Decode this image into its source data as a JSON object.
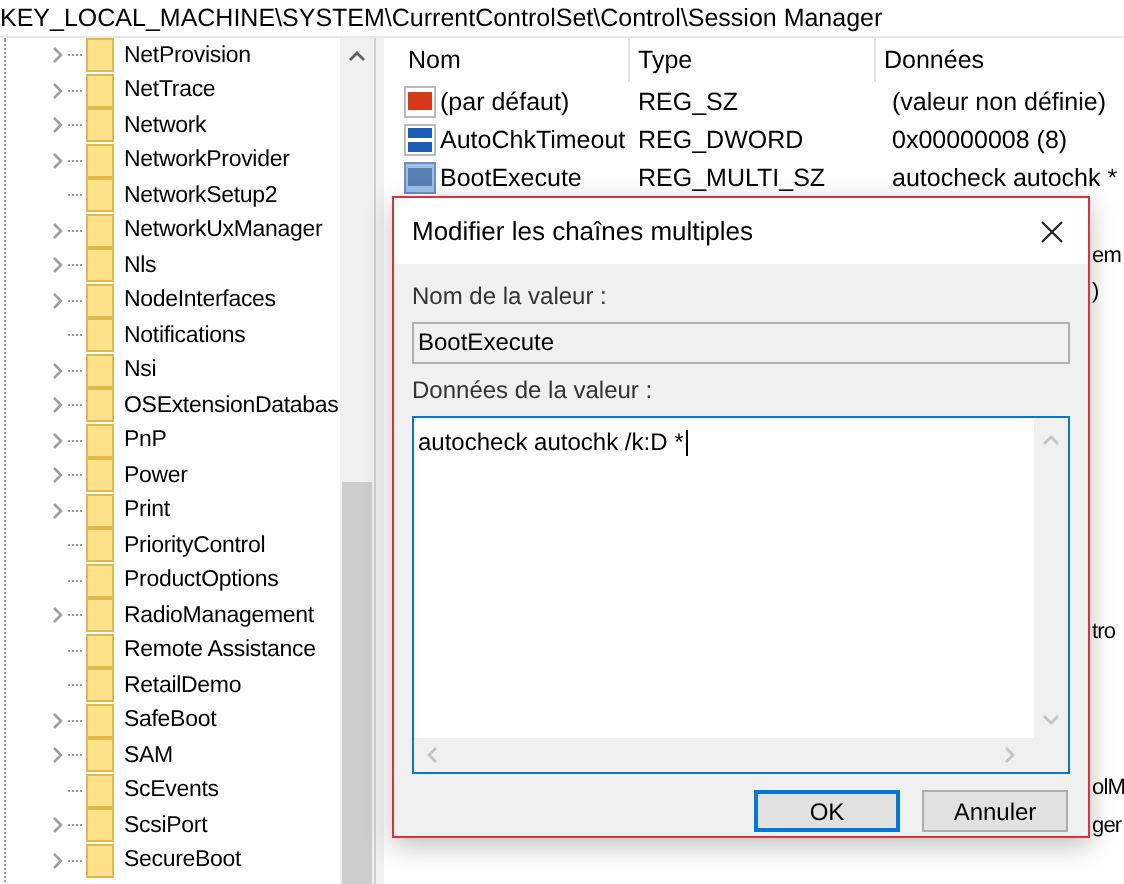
{
  "path_bar": {
    "text": "KEY_LOCAL_MACHINE\\SYSTEM\\CurrentControlSet\\Control\\Session Manager"
  },
  "tree": {
    "items": [
      {
        "label": "NetProvision",
        "expandable": true
      },
      {
        "label": "NetTrace",
        "expandable": true
      },
      {
        "label": "Network",
        "expandable": true
      },
      {
        "label": "NetworkProvider",
        "expandable": true
      },
      {
        "label": "NetworkSetup2",
        "expandable": false
      },
      {
        "label": "NetworkUxManager",
        "expandable": true
      },
      {
        "label": "Nls",
        "expandable": true
      },
      {
        "label": "NodeInterfaces",
        "expandable": true
      },
      {
        "label": "Notifications",
        "expandable": false
      },
      {
        "label": "Nsi",
        "expandable": true
      },
      {
        "label": "OSExtensionDatabas",
        "expandable": true
      },
      {
        "label": "PnP",
        "expandable": true
      },
      {
        "label": "Power",
        "expandable": true
      },
      {
        "label": "Print",
        "expandable": true
      },
      {
        "label": "PriorityControl",
        "expandable": false
      },
      {
        "label": "ProductOptions",
        "expandable": false
      },
      {
        "label": "RadioManagement",
        "expandable": true
      },
      {
        "label": "Remote Assistance",
        "expandable": false
      },
      {
        "label": "RetailDemo",
        "expandable": false
      },
      {
        "label": "SafeBoot",
        "expandable": true
      },
      {
        "label": "SAM",
        "expandable": true
      },
      {
        "label": "ScEvents",
        "expandable": false
      },
      {
        "label": "ScsiPort",
        "expandable": true
      },
      {
        "label": "SecureBoot",
        "expandable": true
      }
    ]
  },
  "values": {
    "columns": [
      "Nom",
      "Type",
      "Données"
    ],
    "rows": [
      {
        "kind": "string",
        "name": "(par défaut)",
        "type": "REG_SZ",
        "data": "(valeur non définie)"
      },
      {
        "kind": "binary",
        "name": "AutoChkTimeout",
        "type": "REG_DWORD",
        "data": "0x00000008 (8)"
      },
      {
        "kind": "multi",
        "name": "BootExecute",
        "type": "REG_MULTI_SZ",
        "data": "autocheck autochk *"
      }
    ],
    "hidden_fragments": [
      "em",
      ")",
      "tro",
      "olM",
      "ger"
    ]
  },
  "dialog": {
    "title": "Modifier les chaînes multiples",
    "name_label": "Nom de la valeur :",
    "name_value": "BootExecute",
    "data_label": "Données de la valeur :",
    "data_value": "autocheck autochk /k:D *",
    "buttons": [
      {
        "label": "OK",
        "default": true
      },
      {
        "label": "Annuler",
        "default": false
      }
    ]
  }
}
